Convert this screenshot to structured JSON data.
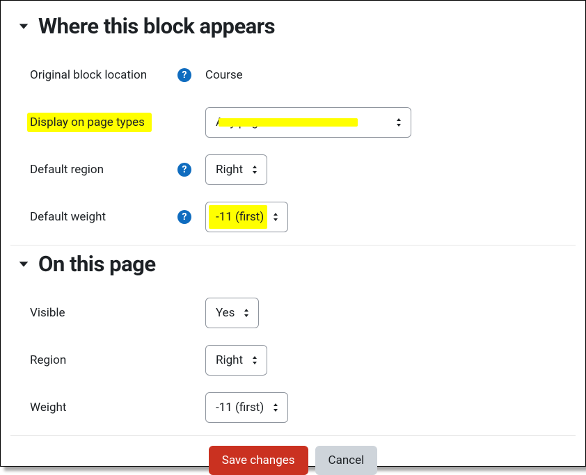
{
  "sections": {
    "appears": {
      "title": "Where this block appears",
      "original_block_location": {
        "label": "Original block location",
        "value": "Course"
      },
      "display_on_page_types": {
        "label": "Display on page types",
        "value": "Any page"
      },
      "default_region": {
        "label": "Default region",
        "value": "Right"
      },
      "default_weight": {
        "label": "Default weight",
        "value": "-11 (first)"
      }
    },
    "onthispage": {
      "title": "On this page",
      "visible": {
        "label": "Visible",
        "value": "Yes"
      },
      "region": {
        "label": "Region",
        "value": "Right"
      },
      "weight": {
        "label": "Weight",
        "value": "-11 (first)"
      }
    }
  },
  "buttons": {
    "save": "Save changes",
    "cancel": "Cancel"
  }
}
